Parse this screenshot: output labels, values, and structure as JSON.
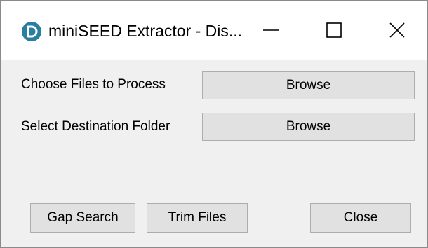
{
  "window": {
    "title": "miniSEED Extractor - Dis...",
    "app_icon_letter": "D",
    "accent_color": "#2a7fa0"
  },
  "titlebar_controls": {
    "minimize_icon": "minimize-icon",
    "maximize_icon": "maximize-icon",
    "close_icon": "close-icon"
  },
  "form": {
    "choose_files_label": "Choose Files to Process",
    "choose_files_button": "Browse",
    "destination_label": "Select Destination Folder",
    "destination_button": "Browse"
  },
  "actions": {
    "gap_search": "Gap Search",
    "trim_files": "Trim Files",
    "close": "Close"
  }
}
